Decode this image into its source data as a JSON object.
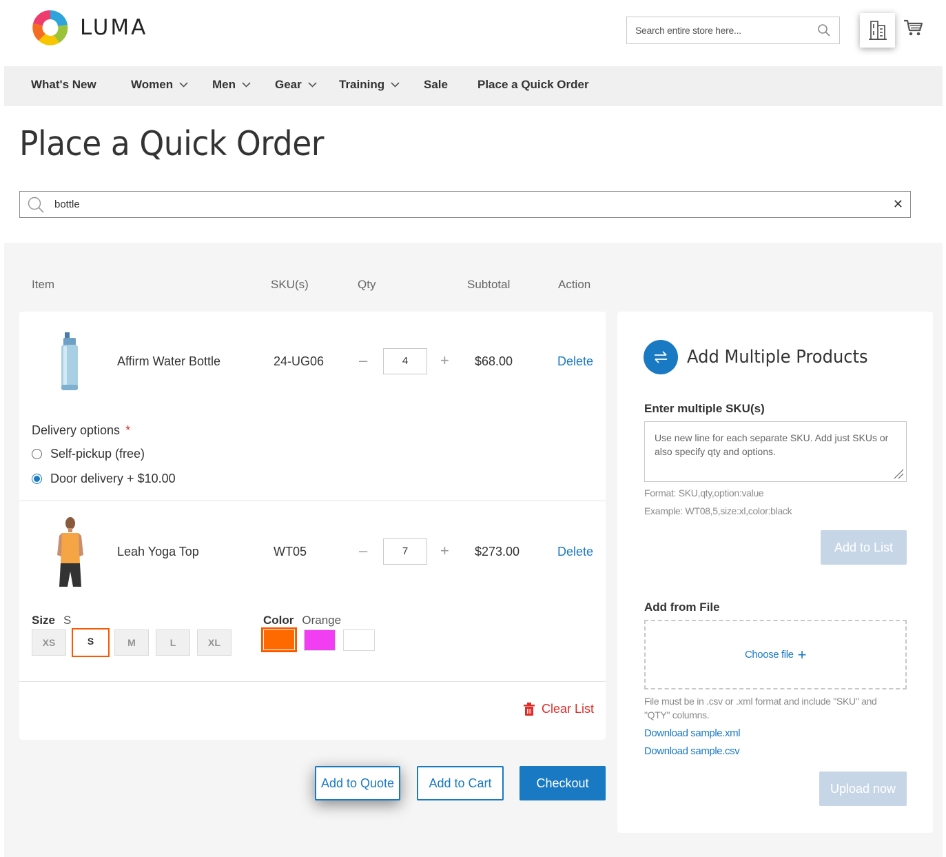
{
  "header": {
    "logo_text": "LUMA",
    "search_placeholder": "Search entire store here..."
  },
  "nav": {
    "items": [
      {
        "label": "What's New",
        "has_dropdown": false
      },
      {
        "label": "Women",
        "has_dropdown": true
      },
      {
        "label": "Men",
        "has_dropdown": true
      },
      {
        "label": "Gear",
        "has_dropdown": true
      },
      {
        "label": "Training",
        "has_dropdown": true
      },
      {
        "label": "Sale",
        "has_dropdown": false
      },
      {
        "label": "Place a Quick Order",
        "has_dropdown": false
      }
    ]
  },
  "page_title": "Place a Quick Order",
  "product_search": {
    "value": "bottle"
  },
  "table": {
    "headers": [
      "Item",
      "SKU(s)",
      "Qty",
      "Subtotal",
      "Action"
    ]
  },
  "items": [
    {
      "name": "Affirm Water Bottle",
      "sku": "24-UG06",
      "qty": "4",
      "subtotal": "$68.00",
      "action": "Delete",
      "delivery": {
        "label": "Delivery options",
        "required_mark": "*",
        "options": [
          {
            "label": "Self-pickup (free)",
            "checked": false
          },
          {
            "label": "Door delivery + $10.00",
            "checked": true
          }
        ]
      }
    },
    {
      "name": "Leah Yoga Top",
      "sku": "WT05",
      "qty": "7",
      "subtotal": "$273.00",
      "action": "Delete",
      "size": {
        "label": "Size",
        "selected": "S",
        "options": [
          "XS",
          "S",
          "M",
          "L",
          "XL"
        ]
      },
      "color": {
        "label": "Color",
        "selected": "Orange",
        "options": [
          "#ff6a00",
          "#f23ef2",
          "#ffffff"
        ]
      }
    }
  ],
  "clear_list": "Clear List",
  "buttons": {
    "add_to_quote": "Add to Quote",
    "add_to_cart": "Add to Cart",
    "checkout": "Checkout"
  },
  "multi": {
    "title": "Add Multiple Products",
    "sku_label": "Enter multiple SKU(s)",
    "sku_placeholder": "Use new line for each separate SKU. Add just SKUs or also specify qty and options.",
    "format_note": "Format: SKU,qty,option:value",
    "example_note": "Example: WT08,5,size:xl,color:black",
    "add_to_list": "Add to List",
    "file_label": "Add from File",
    "choose_file": "Choose file",
    "file_note": "File must be in .csv or .xml format and include \"SKU\" and \"QTY\" columns.",
    "download_xml": "Download sample.xml",
    "download_csv": "Download sample.csv",
    "upload_now": "Upload now"
  },
  "colors": {
    "accent": "#1979c3",
    "danger": "#e02b27",
    "swatch_selected_border": "#ff5501"
  }
}
